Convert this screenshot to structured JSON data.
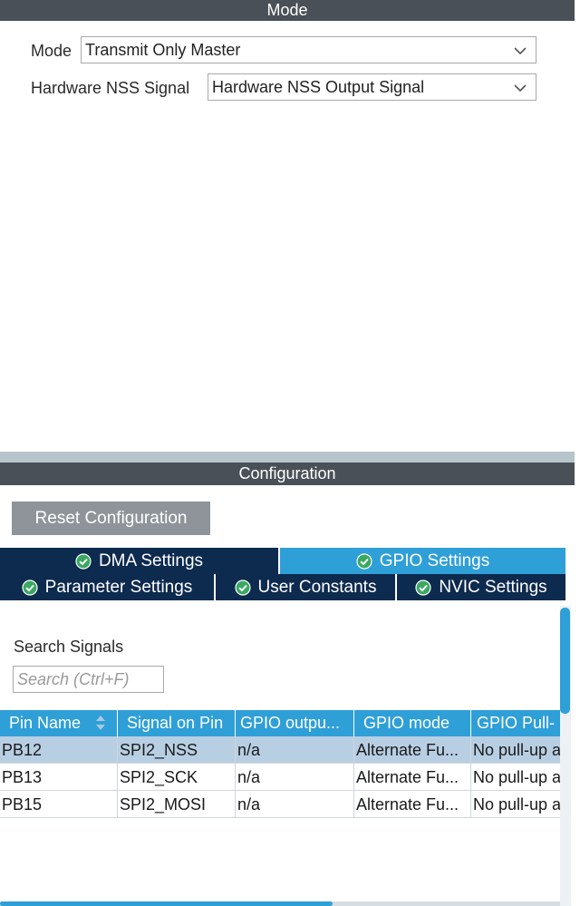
{
  "mode_panel": {
    "title": "Mode",
    "mode_label": "Mode",
    "mode_value": "Transmit Only Master",
    "nss_label": "Hardware NSS Signal",
    "nss_value": "Hardware NSS Output Signal"
  },
  "config_panel": {
    "title": "Configuration",
    "reset_label": "Reset Configuration",
    "tabs": [
      {
        "label": "DMA Settings",
        "active": false
      },
      {
        "label": "GPIO Settings",
        "active": true
      },
      {
        "label": "Parameter Settings",
        "active": false
      },
      {
        "label": "User Constants",
        "active": false
      },
      {
        "label": "NVIC Settings",
        "active": false
      }
    ],
    "search_label": "Search Signals",
    "search_placeholder": "Search (Ctrl+F)",
    "table": {
      "columns": [
        "Pin Name",
        "Signal on Pin",
        "GPIO outpu...",
        "GPIO mode",
        "GPIO Pull-"
      ],
      "rows": [
        [
          "PB12",
          "SPI2_NSS",
          "n/a",
          "Alternate Fu...",
          "No pull-up a"
        ],
        [
          "PB13",
          "SPI2_SCK",
          "n/a",
          "Alternate Fu...",
          "No pull-up a"
        ],
        [
          "PB15",
          "SPI2_MOSI",
          "n/a",
          "Alternate Fu...",
          "No pull-up a"
        ]
      ],
      "selected_row": 0
    }
  },
  "colors": {
    "header_bg": "#4a5057",
    "tab_bg": "#0d2a4f",
    "accent": "#2f9fd8",
    "selected_row": "#b8cfe3",
    "check_green": "#3aa860"
  },
  "icons": {
    "dropdown": "chevron-down-icon",
    "tab_status": "check-circle-icon",
    "sort": "sort-icon"
  }
}
